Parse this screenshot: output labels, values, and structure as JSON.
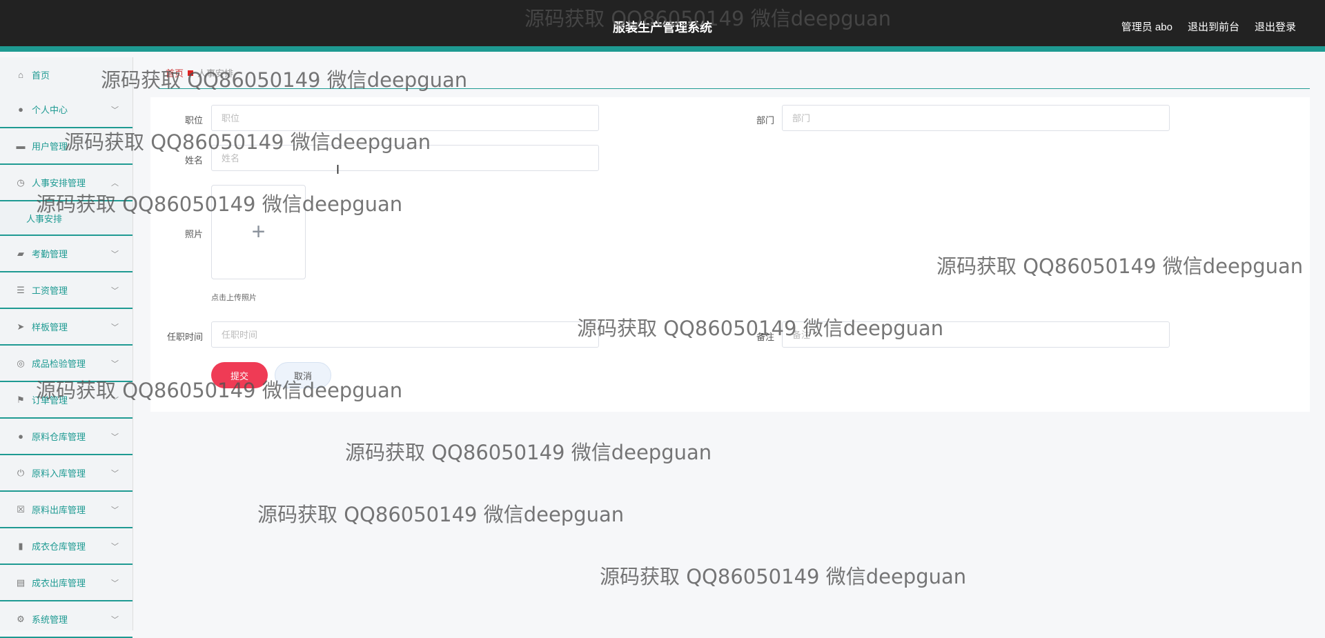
{
  "header": {
    "title": "服装生产管理系统",
    "user": "管理员 abo",
    "to_front": "退出到前台",
    "logout": "退出登录"
  },
  "sidebar": {
    "items": [
      {
        "label": "首页",
        "icon": "home-icon"
      },
      {
        "label": "个人中心",
        "icon": "user-icon"
      },
      {
        "label": "用户管理",
        "icon": "monitor-icon"
      },
      {
        "label": "人事安排管理",
        "icon": "dashboard-icon"
      },
      {
        "label": "考勤管理",
        "icon": "chat-icon"
      },
      {
        "label": "工资管理",
        "icon": "list-icon"
      },
      {
        "label": "样板管理",
        "icon": "send-icon"
      },
      {
        "label": "成品检验管理",
        "icon": "target-icon"
      },
      {
        "label": "订单管理",
        "icon": "flag-icon"
      },
      {
        "label": "原料仓库管理",
        "icon": "user-icon"
      },
      {
        "label": "原料入库管理",
        "icon": "power-icon"
      },
      {
        "label": "原料出库管理",
        "icon": "clipboard-x-icon"
      },
      {
        "label": "成衣仓库管理",
        "icon": "bar-chart-icon"
      },
      {
        "label": "成衣出库管理",
        "icon": "clipboard-icon"
      },
      {
        "label": "系统管理",
        "icon": "settings-icon"
      }
    ],
    "sub_item": "人事安排"
  },
  "breadcrumb": {
    "home": "首页",
    "current": "人事安排"
  },
  "form": {
    "position_label": "职位",
    "position_placeholder": "职位",
    "department_label": "部门",
    "department_placeholder": "部门",
    "name_label": "姓名",
    "name_placeholder": "姓名",
    "photo_label": "照片",
    "upload_tip": "点击上传照片",
    "date_label": "任职时间",
    "date_placeholder": "任职时间",
    "remark_label": "备注",
    "remark_placeholder": "备注",
    "submit": "提交",
    "cancel": "取消"
  },
  "watermark": "源码获取 QQ86050149 微信deepguan",
  "colors": {
    "accent": "#1e9a92",
    "submit": "#ef3b55",
    "header_bg": "#222222"
  }
}
